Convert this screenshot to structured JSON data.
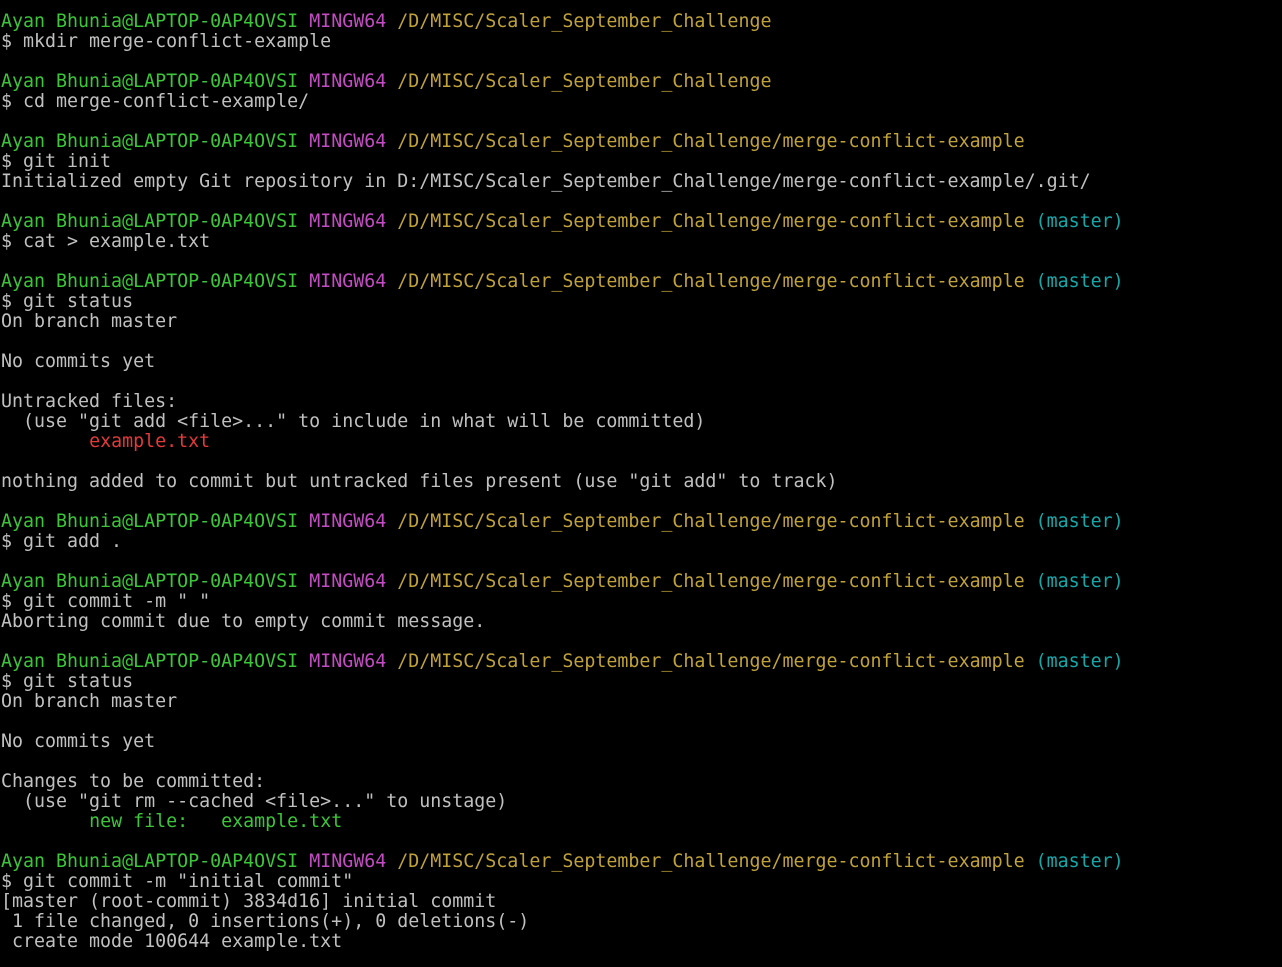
{
  "terminal": {
    "colors": {
      "background": "#000000",
      "text": "#c0c0c0",
      "user_host": "#3bc639",
      "msystem": "#c34bc3",
      "path": "#c0a23a",
      "branch": "#16a8a8",
      "untracked_file": "#e23a3a",
      "staged_file": "#3bc639"
    },
    "lines": [
      {
        "name": "prompt-line",
        "segments": [
          {
            "t": "Ayan Bhunia@LAPTOP-0AP4OVSI",
            "c": "user"
          },
          {
            "t": " ",
            "c": "text"
          },
          {
            "t": "MINGW64",
            "c": "msys"
          },
          {
            "t": " ",
            "c": "text"
          },
          {
            "t": "/D/MISC/Scaler_September_Challenge",
            "c": "path"
          }
        ]
      },
      {
        "name": "command-line",
        "segments": [
          {
            "t": "$ mkdir merge-conflict-example",
            "c": "text"
          }
        ]
      },
      {
        "name": "blank-line",
        "segments": []
      },
      {
        "name": "prompt-line",
        "segments": [
          {
            "t": "Ayan Bhunia@LAPTOP-0AP4OVSI",
            "c": "user"
          },
          {
            "t": " ",
            "c": "text"
          },
          {
            "t": "MINGW64",
            "c": "msys"
          },
          {
            "t": " ",
            "c": "text"
          },
          {
            "t": "/D/MISC/Scaler_September_Challenge",
            "c": "path"
          }
        ]
      },
      {
        "name": "command-line",
        "segments": [
          {
            "t": "$ cd merge-conflict-example/",
            "c": "text"
          }
        ]
      },
      {
        "name": "blank-line",
        "segments": []
      },
      {
        "name": "prompt-line",
        "segments": [
          {
            "t": "Ayan Bhunia@LAPTOP-0AP4OVSI",
            "c": "user"
          },
          {
            "t": " ",
            "c": "text"
          },
          {
            "t": "MINGW64",
            "c": "msys"
          },
          {
            "t": " ",
            "c": "text"
          },
          {
            "t": "/D/MISC/Scaler_September_Challenge/merge-conflict-example",
            "c": "path"
          }
        ]
      },
      {
        "name": "command-line",
        "segments": [
          {
            "t": "$ git init",
            "c": "text"
          }
        ]
      },
      {
        "name": "output-line",
        "segments": [
          {
            "t": "Initialized empty Git repository in D:/MISC/Scaler_September_Challenge/merge-conflict-example/.git/",
            "c": "text"
          }
        ]
      },
      {
        "name": "blank-line",
        "segments": []
      },
      {
        "name": "prompt-line",
        "segments": [
          {
            "t": "Ayan Bhunia@LAPTOP-0AP4OVSI",
            "c": "user"
          },
          {
            "t": " ",
            "c": "text"
          },
          {
            "t": "MINGW64",
            "c": "msys"
          },
          {
            "t": " ",
            "c": "text"
          },
          {
            "t": "/D/MISC/Scaler_September_Challenge/merge-conflict-example",
            "c": "path"
          },
          {
            "t": " ",
            "c": "text"
          },
          {
            "t": "(master)",
            "c": "branch"
          }
        ]
      },
      {
        "name": "command-line",
        "segments": [
          {
            "t": "$ cat > example.txt",
            "c": "text"
          }
        ]
      },
      {
        "name": "blank-line",
        "segments": []
      },
      {
        "name": "prompt-line",
        "segments": [
          {
            "t": "Ayan Bhunia@LAPTOP-0AP4OVSI",
            "c": "user"
          },
          {
            "t": " ",
            "c": "text"
          },
          {
            "t": "MINGW64",
            "c": "msys"
          },
          {
            "t": " ",
            "c": "text"
          },
          {
            "t": "/D/MISC/Scaler_September_Challenge/merge-conflict-example",
            "c": "path"
          },
          {
            "t": " ",
            "c": "text"
          },
          {
            "t": "(master)",
            "c": "branch"
          }
        ]
      },
      {
        "name": "command-line",
        "segments": [
          {
            "t": "$ git status",
            "c": "text"
          }
        ]
      },
      {
        "name": "output-line",
        "segments": [
          {
            "t": "On branch master",
            "c": "text"
          }
        ]
      },
      {
        "name": "blank-line",
        "segments": []
      },
      {
        "name": "output-line",
        "segments": [
          {
            "t": "No commits yet",
            "c": "text"
          }
        ]
      },
      {
        "name": "blank-line",
        "segments": []
      },
      {
        "name": "output-line",
        "segments": [
          {
            "t": "Untracked files:",
            "c": "text"
          }
        ]
      },
      {
        "name": "output-line",
        "segments": [
          {
            "t": "  (use \"git add <file>...\" to include in what will be committed)",
            "c": "text"
          }
        ]
      },
      {
        "name": "output-line",
        "segments": [
          {
            "t": "        ",
            "c": "text"
          },
          {
            "t": "example.txt",
            "c": "red"
          }
        ]
      },
      {
        "name": "blank-line",
        "segments": []
      },
      {
        "name": "output-line",
        "segments": [
          {
            "t": "nothing added to commit but untracked files present (use \"git add\" to track)",
            "c": "text"
          }
        ]
      },
      {
        "name": "blank-line",
        "segments": []
      },
      {
        "name": "prompt-line",
        "segments": [
          {
            "t": "Ayan Bhunia@LAPTOP-0AP4OVSI",
            "c": "user"
          },
          {
            "t": " ",
            "c": "text"
          },
          {
            "t": "MINGW64",
            "c": "msys"
          },
          {
            "t": " ",
            "c": "text"
          },
          {
            "t": "/D/MISC/Scaler_September_Challenge/merge-conflict-example",
            "c": "path"
          },
          {
            "t": " ",
            "c": "text"
          },
          {
            "t": "(master)",
            "c": "branch"
          }
        ]
      },
      {
        "name": "command-line",
        "segments": [
          {
            "t": "$ git add .",
            "c": "text"
          }
        ]
      },
      {
        "name": "blank-line",
        "segments": []
      },
      {
        "name": "prompt-line",
        "segments": [
          {
            "t": "Ayan Bhunia@LAPTOP-0AP4OVSI",
            "c": "user"
          },
          {
            "t": " ",
            "c": "text"
          },
          {
            "t": "MINGW64",
            "c": "msys"
          },
          {
            "t": " ",
            "c": "text"
          },
          {
            "t": "/D/MISC/Scaler_September_Challenge/merge-conflict-example",
            "c": "path"
          },
          {
            "t": " ",
            "c": "text"
          },
          {
            "t": "(master)",
            "c": "branch"
          }
        ]
      },
      {
        "name": "command-line",
        "segments": [
          {
            "t": "$ git commit -m \" \"",
            "c": "text"
          }
        ]
      },
      {
        "name": "output-line",
        "segments": [
          {
            "t": "Aborting commit due to empty commit message.",
            "c": "text"
          }
        ]
      },
      {
        "name": "blank-line",
        "segments": []
      },
      {
        "name": "prompt-line",
        "segments": [
          {
            "t": "Ayan Bhunia@LAPTOP-0AP4OVSI",
            "c": "user"
          },
          {
            "t": " ",
            "c": "text"
          },
          {
            "t": "MINGW64",
            "c": "msys"
          },
          {
            "t": " ",
            "c": "text"
          },
          {
            "t": "/D/MISC/Scaler_September_Challenge/merge-conflict-example",
            "c": "path"
          },
          {
            "t": " ",
            "c": "text"
          },
          {
            "t": "(master)",
            "c": "branch"
          }
        ]
      },
      {
        "name": "command-line",
        "segments": [
          {
            "t": "$ git status",
            "c": "text"
          }
        ]
      },
      {
        "name": "output-line",
        "segments": [
          {
            "t": "On branch master",
            "c": "text"
          }
        ]
      },
      {
        "name": "blank-line",
        "segments": []
      },
      {
        "name": "output-line",
        "segments": [
          {
            "t": "No commits yet",
            "c": "text"
          }
        ]
      },
      {
        "name": "blank-line",
        "segments": []
      },
      {
        "name": "output-line",
        "segments": [
          {
            "t": "Changes to be committed:",
            "c": "text"
          }
        ]
      },
      {
        "name": "output-line",
        "segments": [
          {
            "t": "  (use \"git rm --cached <file>...\" to unstage)",
            "c": "text"
          }
        ]
      },
      {
        "name": "output-line",
        "segments": [
          {
            "t": "        ",
            "c": "text"
          },
          {
            "t": "new file:   example.txt",
            "c": "green"
          }
        ]
      },
      {
        "name": "blank-line",
        "segments": []
      },
      {
        "name": "prompt-line",
        "segments": [
          {
            "t": "Ayan Bhunia@LAPTOP-0AP4OVSI",
            "c": "user"
          },
          {
            "t": " ",
            "c": "text"
          },
          {
            "t": "MINGW64",
            "c": "msys"
          },
          {
            "t": " ",
            "c": "text"
          },
          {
            "t": "/D/MISC/Scaler_September_Challenge/merge-conflict-example",
            "c": "path"
          },
          {
            "t": " ",
            "c": "text"
          },
          {
            "t": "(master)",
            "c": "branch"
          }
        ]
      },
      {
        "name": "command-line",
        "segments": [
          {
            "t": "$ git commit -m \"initial commit\"",
            "c": "text"
          }
        ]
      },
      {
        "name": "output-line",
        "segments": [
          {
            "t": "[master (root-commit) 3834d16] initial commit",
            "c": "text"
          }
        ]
      },
      {
        "name": "output-line",
        "segments": [
          {
            "t": " 1 file changed, 0 insertions(+), 0 deletions(-)",
            "c": "text"
          }
        ]
      },
      {
        "name": "output-line",
        "segments": [
          {
            "t": " create mode 100644 example.txt",
            "c": "text"
          }
        ]
      }
    ]
  }
}
